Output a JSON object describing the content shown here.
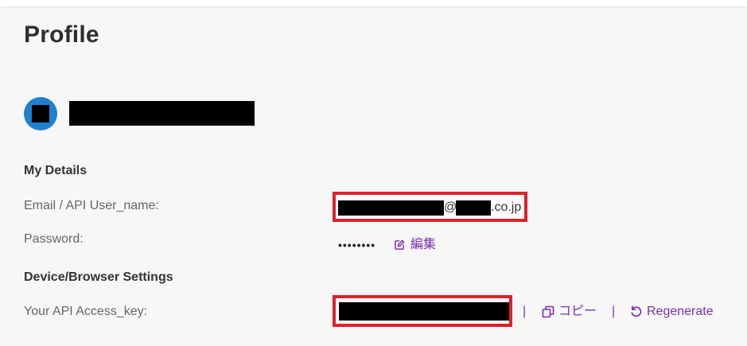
{
  "page": {
    "title": "Profile"
  },
  "profile": {
    "avatar_color": "#1f7fd0"
  },
  "my_details": {
    "heading": "My Details",
    "email_label": "Email / API User_name:",
    "email_at": "@",
    "email_domain_suffix": ".co.jp",
    "password_label": "Password:",
    "password_value": "••••••••",
    "edit_label": "編集",
    "edit_icon": "pencil-square-icon"
  },
  "device_settings": {
    "heading": "Device/Browser Settings",
    "access_key_label": "Your API Access_key:",
    "separator": "|",
    "copy_label": "コピー",
    "copy_icon": "copy-icon",
    "regenerate_label": "Regenerate",
    "regenerate_icon": "rotate-icon"
  },
  "colors": {
    "accent": "#7a2fb5",
    "highlight": "#e0202a"
  }
}
